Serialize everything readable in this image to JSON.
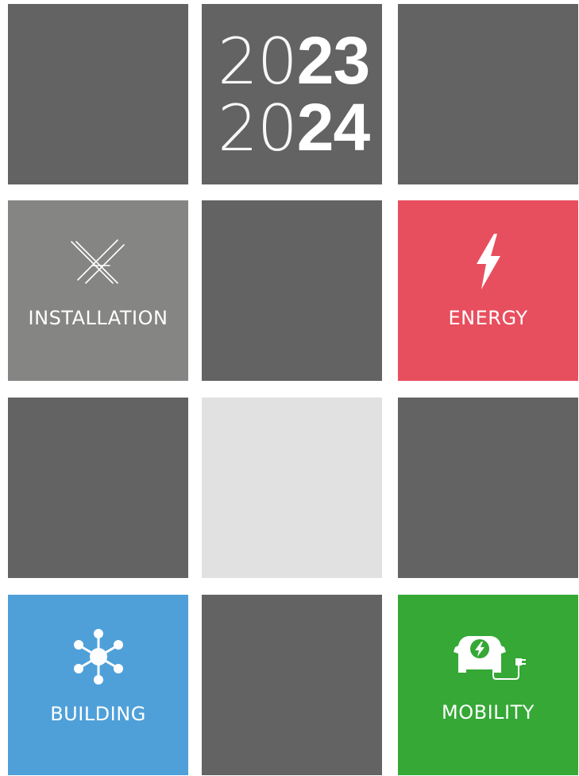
{
  "year": {
    "line1_light": "20",
    "line1_bold": "23",
    "line2_light": "20",
    "line2_bold": "24"
  },
  "tiles": {
    "installation": {
      "label": "INSTALLATION",
      "icon": "installation-cables-icon",
      "color": "#858684"
    },
    "energy": {
      "label": "ENERGY",
      "icon": "lightning-bolt-icon",
      "color": "#e84f5e"
    },
    "building": {
      "label": "BUILDING",
      "icon": "network-hub-icon",
      "color": "#4fa0d9"
    },
    "mobility": {
      "label": "MOBILITY",
      "icon": "ev-charging-car-icon",
      "color": "#35a836"
    },
    "neutral_color": "#636363",
    "light_color": "#e1e1e1"
  }
}
